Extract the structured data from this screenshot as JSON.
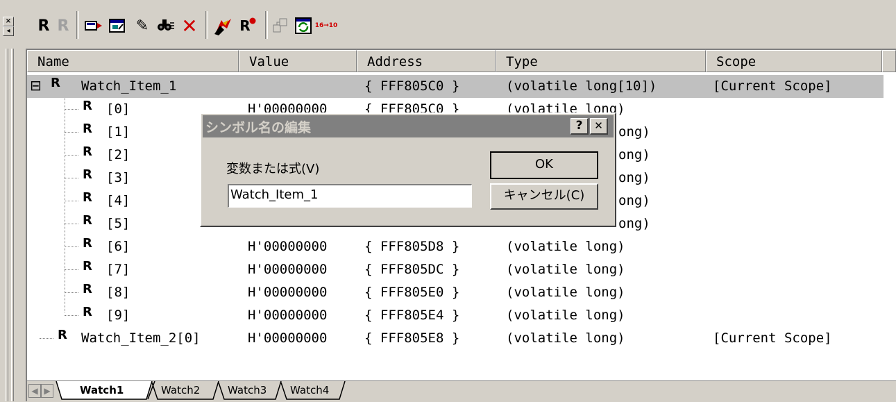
{
  "toolbar": {
    "buttons": [
      {
        "name": "r-icon",
        "glyph": "R"
      },
      {
        "name": "r-disabled-icon",
        "glyph": "R"
      },
      {
        "name": "add-watch-icon",
        "glyph": ""
      },
      {
        "name": "window-icon",
        "glyph": ""
      },
      {
        "name": "edit-pencil-icon",
        "glyph": "✎"
      },
      {
        "name": "find-icon",
        "glyph": ""
      },
      {
        "name": "delete-icon",
        "glyph": "✕"
      },
      {
        "name": "refresh-watch-icon",
        "glyph": ""
      },
      {
        "name": "record-icon",
        "glyph": "R"
      },
      {
        "name": "copy-icon",
        "glyph": ""
      },
      {
        "name": "auto-update-icon",
        "glyph": ""
      },
      {
        "name": "radix-icon",
        "glyph": "16→10"
      }
    ]
  },
  "grip": {
    "close_glyph": "×",
    "left_glyph": "◂"
  },
  "columns": {
    "name": "Name",
    "value": "Value",
    "address": "Address",
    "type": "Type",
    "scope": "Scope"
  },
  "rows": [
    {
      "label": "Watch_Item_1",
      "value": "",
      "address": "{ FFF805C0 }",
      "type": "(volatile long[10])",
      "scope": "[Current Scope]"
    },
    {
      "label": "[0]",
      "value": "H'00000000",
      "address": "{ FFF805C0 }",
      "type": "(volatile long)",
      "scope": ""
    },
    {
      "label": "[1]",
      "value": "",
      "address": "",
      "type": "ong)",
      "scope": ""
    },
    {
      "label": "[2]",
      "value": "",
      "address": "",
      "type": "ong)",
      "scope": ""
    },
    {
      "label": "[3]",
      "value": "",
      "address": "",
      "type": "ong)",
      "scope": ""
    },
    {
      "label": "[4]",
      "value": "",
      "address": "",
      "type": "ong)",
      "scope": ""
    },
    {
      "label": "[5]",
      "value": "",
      "address": "",
      "type": "ong)",
      "scope": ""
    },
    {
      "label": "[6]",
      "value": "H'00000000",
      "address": "{ FFF805D8 }",
      "type": "(volatile long)",
      "scope": ""
    },
    {
      "label": "[7]",
      "value": "H'00000000",
      "address": "{ FFF805DC }",
      "type": "(volatile long)",
      "scope": ""
    },
    {
      "label": "[8]",
      "value": "H'00000000",
      "address": "{ FFF805E0 }",
      "type": "(volatile long)",
      "scope": ""
    },
    {
      "label": "[9]",
      "value": "H'00000000",
      "address": "{ FFF805E4 }",
      "type": "(volatile long)",
      "scope": ""
    },
    {
      "label": "Watch_Item_2[0]",
      "value": "H'00000000",
      "address": "{ FFF805E8 }",
      "type": "(volatile long)",
      "scope": "[Current Scope]"
    }
  ],
  "tree": {
    "expander": "⊟",
    "row_icon": "R"
  },
  "tabs": {
    "scroll_left": "◀",
    "scroll_right": "▶",
    "items": [
      "Watch1",
      "Watch2",
      "Watch3",
      "Watch4"
    ]
  },
  "dialog": {
    "title": "シンボル名の編集",
    "help_glyph": "?",
    "close_glyph": "✕",
    "field_label": "変数または式(V)",
    "field_value": "Watch_Item_1",
    "ok_label": "OK",
    "cancel_label": "キャンセル(C)"
  },
  "colors": {
    "face": "#d4d0c8",
    "selected_row": "#c0c0c0",
    "dialog_title": "#808080"
  }
}
